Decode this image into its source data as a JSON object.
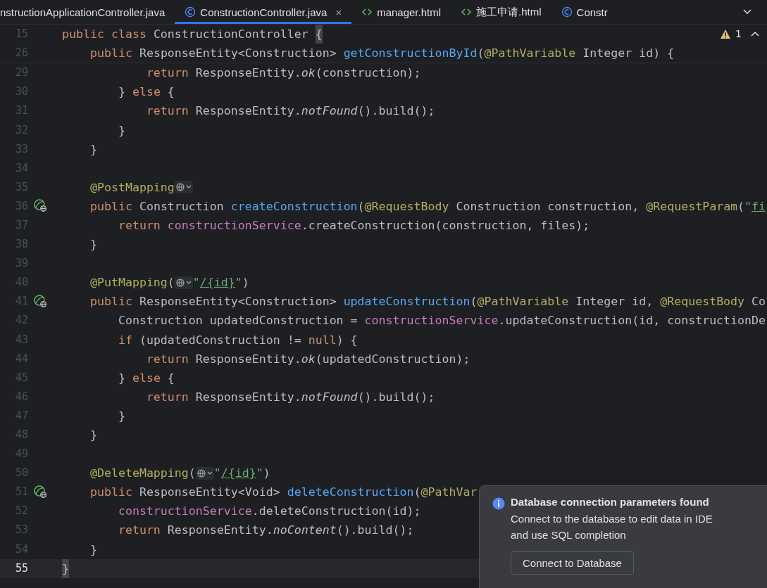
{
  "tabs": [
    {
      "label": "nstructionApplicationController.java",
      "kind": "plain",
      "selected": false
    },
    {
      "label": "ConstructionController.java",
      "kind": "java",
      "selected": true,
      "close": "×"
    },
    {
      "label": "manager.html",
      "kind": "html",
      "selected": false
    },
    {
      "label": "施工申请.html",
      "kind": "html",
      "selected": false
    },
    {
      "label": "Constr",
      "kind": "java",
      "selected": false
    }
  ],
  "inspections": {
    "count": "1"
  },
  "sticky_lines": [
    {
      "num": "15",
      "tokens": [
        {
          "kind": "kw",
          "text": "public class "
        },
        {
          "kind": "plain",
          "text": "ConstructionController "
        },
        {
          "kind": "brace",
          "text": "{"
        }
      ]
    },
    {
      "num": "26",
      "tokens": [
        {
          "kind": "kw",
          "text": "    public "
        },
        {
          "kind": "plain",
          "text": "ResponseEntity<Construction> "
        },
        {
          "kind": "fn",
          "text": "getConstructionById"
        },
        {
          "kind": "plain",
          "text": "("
        },
        {
          "kind": "ann",
          "text": "@PathVariable"
        },
        {
          "kind": "plain",
          "text": " Integer id) {"
        }
      ]
    }
  ],
  "lines": [
    {
      "num": "29",
      "marker": false,
      "current": false,
      "tokens": [
        {
          "kind": "kw",
          "text": "            return "
        },
        {
          "kind": "plain",
          "text": "ResponseEntity."
        },
        {
          "kind": "it",
          "text": "ok"
        },
        {
          "kind": "plain",
          "text": "(construction);"
        }
      ]
    },
    {
      "num": "30",
      "marker": false,
      "current": false,
      "tokens": [
        {
          "kind": "plain",
          "text": "        } "
        },
        {
          "kind": "kw",
          "text": "else"
        },
        {
          "kind": "plain",
          "text": " {"
        }
      ]
    },
    {
      "num": "31",
      "marker": false,
      "current": false,
      "tokens": [
        {
          "kind": "kw",
          "text": "            return "
        },
        {
          "kind": "plain",
          "text": "ResponseEntity."
        },
        {
          "kind": "it",
          "text": "notFound"
        },
        {
          "kind": "plain",
          "text": "().build();"
        }
      ]
    },
    {
      "num": "32",
      "marker": false,
      "current": false,
      "tokens": [
        {
          "kind": "plain",
          "text": "        }"
        }
      ]
    },
    {
      "num": "33",
      "marker": false,
      "current": false,
      "tokens": [
        {
          "kind": "plain",
          "text": "    }"
        }
      ]
    },
    {
      "num": "34",
      "marker": false,
      "current": false
    },
    {
      "num": "35",
      "marker": false,
      "current": false,
      "tokens": [
        {
          "kind": "ann",
          "text": "    @PostMapping"
        },
        {
          "kind": "inlay"
        }
      ]
    },
    {
      "num": "36",
      "marker": true,
      "current": false,
      "tokens": [
        {
          "kind": "kw",
          "text": "    public "
        },
        {
          "kind": "plain",
          "text": "Construction "
        },
        {
          "kind": "fn",
          "text": "createConstruction"
        },
        {
          "kind": "plain",
          "text": "("
        },
        {
          "kind": "ann",
          "text": "@RequestBody"
        },
        {
          "kind": "plain",
          "text": " Construction construction, "
        },
        {
          "kind": "ann",
          "text": "@RequestParam"
        },
        {
          "kind": "plain",
          "text": "("
        },
        {
          "kind": "str",
          "text": "\""
        },
        {
          "kind": "link",
          "text": "fi"
        }
      ]
    },
    {
      "num": "37",
      "marker": false,
      "current": false,
      "tokens": [
        {
          "kind": "kw",
          "text": "        return "
        },
        {
          "kind": "field",
          "text": "constructionService"
        },
        {
          "kind": "plain",
          "text": ".createConstruction(construction, files);"
        }
      ]
    },
    {
      "num": "38",
      "marker": false,
      "current": false,
      "tokens": [
        {
          "kind": "plain",
          "text": "    }"
        }
      ]
    },
    {
      "num": "39",
      "marker": false,
      "current": false
    },
    {
      "num": "40",
      "marker": false,
      "current": false,
      "tokens": [
        {
          "kind": "ann",
          "text": "    @PutMapping"
        },
        {
          "kind": "plain",
          "text": "("
        },
        {
          "kind": "inlay"
        },
        {
          "kind": "str",
          "text": "\""
        },
        {
          "kind": "link",
          "text": "/{id}"
        },
        {
          "kind": "str",
          "text": "\""
        },
        {
          "kind": "plain",
          "text": ")"
        }
      ]
    },
    {
      "num": "41",
      "marker": true,
      "current": false,
      "tokens": [
        {
          "kind": "kw",
          "text": "    public "
        },
        {
          "kind": "plain",
          "text": "ResponseEntity<Construction> "
        },
        {
          "kind": "fn",
          "text": "updateConstruction"
        },
        {
          "kind": "plain",
          "text": "("
        },
        {
          "kind": "ann",
          "text": "@PathVariable"
        },
        {
          "kind": "plain",
          "text": " Integer id, "
        },
        {
          "kind": "ann",
          "text": "@RequestBody"
        },
        {
          "kind": "plain",
          "text": " Co"
        }
      ]
    },
    {
      "num": "42",
      "marker": false,
      "current": false,
      "tokens": [
        {
          "kind": "plain",
          "text": "        Construction updatedConstruction = "
        },
        {
          "kind": "field",
          "text": "constructionService"
        },
        {
          "kind": "plain",
          "text": ".updateConstruction(id, constructionDe"
        }
      ]
    },
    {
      "num": "43",
      "marker": false,
      "current": false,
      "tokens": [
        {
          "kind": "kw",
          "text": "        if"
        },
        {
          "kind": "plain",
          "text": " (updatedConstruction != "
        },
        {
          "kind": "kw",
          "text": "null"
        },
        {
          "kind": "plain",
          "text": ") {"
        }
      ]
    },
    {
      "num": "44",
      "marker": false,
      "current": false,
      "tokens": [
        {
          "kind": "kw",
          "text": "            return "
        },
        {
          "kind": "plain",
          "text": "ResponseEntity."
        },
        {
          "kind": "it",
          "text": "ok"
        },
        {
          "kind": "plain",
          "text": "(updatedConstruction);"
        }
      ]
    },
    {
      "num": "45",
      "marker": false,
      "current": false,
      "tokens": [
        {
          "kind": "plain",
          "text": "        } "
        },
        {
          "kind": "kw",
          "text": "else"
        },
        {
          "kind": "plain",
          "text": " {"
        }
      ]
    },
    {
      "num": "46",
      "marker": false,
      "current": false,
      "tokens": [
        {
          "kind": "kw",
          "text": "            return "
        },
        {
          "kind": "plain",
          "text": "ResponseEntity."
        },
        {
          "kind": "it",
          "text": "notFound"
        },
        {
          "kind": "plain",
          "text": "().build();"
        }
      ]
    },
    {
      "num": "47",
      "marker": false,
      "current": false,
      "tokens": [
        {
          "kind": "plain",
          "text": "        }"
        }
      ]
    },
    {
      "num": "48",
      "marker": false,
      "current": false,
      "tokens": [
        {
          "kind": "plain",
          "text": "    }"
        }
      ]
    },
    {
      "num": "49",
      "marker": false,
      "current": false
    },
    {
      "num": "50",
      "marker": false,
      "current": false,
      "tokens": [
        {
          "kind": "ann",
          "text": "    @DeleteMapping"
        },
        {
          "kind": "plain",
          "text": "("
        },
        {
          "kind": "inlay"
        },
        {
          "kind": "str",
          "text": "\""
        },
        {
          "kind": "link",
          "text": "/{id}"
        },
        {
          "kind": "str",
          "text": "\""
        },
        {
          "kind": "plain",
          "text": ")"
        }
      ]
    },
    {
      "num": "51",
      "marker": true,
      "current": false,
      "tokens": [
        {
          "kind": "kw",
          "text": "    public "
        },
        {
          "kind": "plain",
          "text": "ResponseEntity<Void> "
        },
        {
          "kind": "fn",
          "text": "deleteConstruction"
        },
        {
          "kind": "plain",
          "text": "("
        },
        {
          "kind": "ann",
          "text": "@PathVar"
        }
      ]
    },
    {
      "num": "52",
      "marker": false,
      "current": false,
      "tokens": [
        {
          "kind": "field",
          "text": "        constructionService"
        },
        {
          "kind": "plain",
          "text": ".deleteConstruction(id);"
        }
      ]
    },
    {
      "num": "53",
      "marker": false,
      "current": false,
      "tokens": [
        {
          "kind": "kw",
          "text": "        return "
        },
        {
          "kind": "plain",
          "text": "ResponseEntity."
        },
        {
          "kind": "it",
          "text": "noContent"
        },
        {
          "kind": "plain",
          "text": "().build();"
        }
      ]
    },
    {
      "num": "54",
      "marker": false,
      "current": false,
      "tokens": [
        {
          "kind": "plain",
          "text": "    }"
        }
      ]
    },
    {
      "num": "55",
      "marker": false,
      "current": true,
      "tokens": [
        {
          "kind": "brace",
          "text": "}"
        }
      ]
    }
  ],
  "notification": {
    "title": "Database connection parameters found",
    "body": "Connect to the database to edit data in IDE and use SQL completion",
    "button": "Connect to Database"
  }
}
